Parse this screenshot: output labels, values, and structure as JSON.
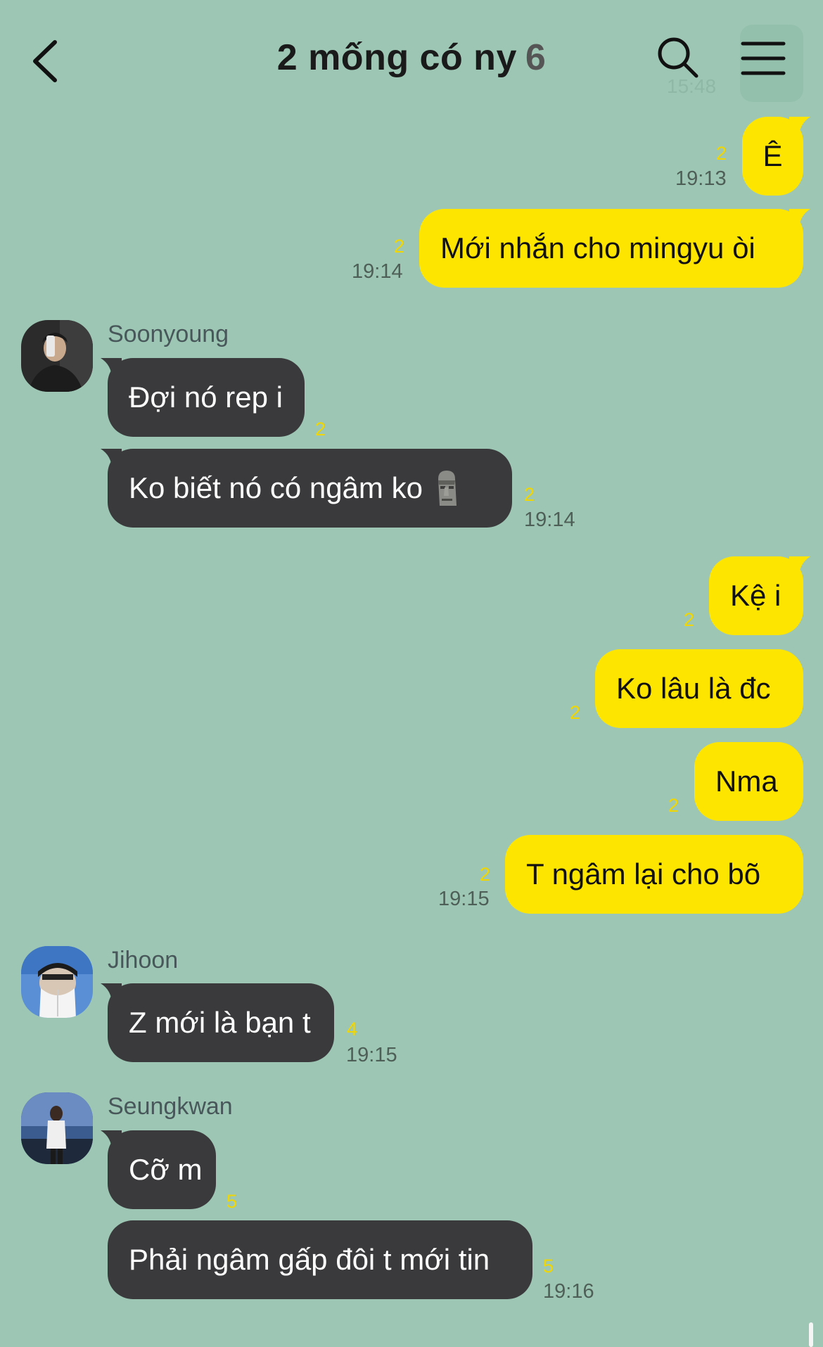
{
  "header": {
    "title": "2 mống có ny",
    "member_count": "6",
    "ghost_time": "15:48"
  },
  "messages": {
    "m1": {
      "text": "Ê",
      "unread": "2",
      "time": "19:13"
    },
    "m2": {
      "text": "Mới nhắn cho mingyu òi",
      "unread": "2",
      "time": "19:14"
    },
    "soonyoung": {
      "name": "Soonyoung",
      "m1": {
        "text": "Đợi nó rep i",
        "unread": "2"
      },
      "m2": {
        "text": "Ko biết nó có ngâm ko",
        "emoji": "moai-emoji",
        "unread": "2",
        "time": "19:14"
      }
    },
    "m3": {
      "text": "Kệ i",
      "unread": "2"
    },
    "m4": {
      "text": "Ko lâu là đc",
      "unread": "2"
    },
    "m5": {
      "text": "Nma",
      "unread": "2"
    },
    "m6": {
      "text": "T ngâm lại cho bõ",
      "unread": "2",
      "time": "19:15"
    },
    "jihoon": {
      "name": "Jihoon",
      "m1": {
        "text": "Z mới là bạn t",
        "unread": "4",
        "time": "19:15"
      }
    },
    "seungkwan": {
      "name": "Seungkwan",
      "m1": {
        "text": "Cỡ m",
        "unread": "5"
      },
      "m2": {
        "text": "Phải ngâm gấp đôi t mới tin",
        "unread": "5",
        "time": "19:16"
      }
    }
  },
  "colors": {
    "background": "#9dc7b4",
    "my_bubble": "#fee500",
    "their_bubble": "#3a3a3c",
    "unread_count": "#f2d600"
  },
  "icons": [
    "back-arrow-icon",
    "search-icon",
    "menu-icon",
    "moai-emoji"
  ]
}
